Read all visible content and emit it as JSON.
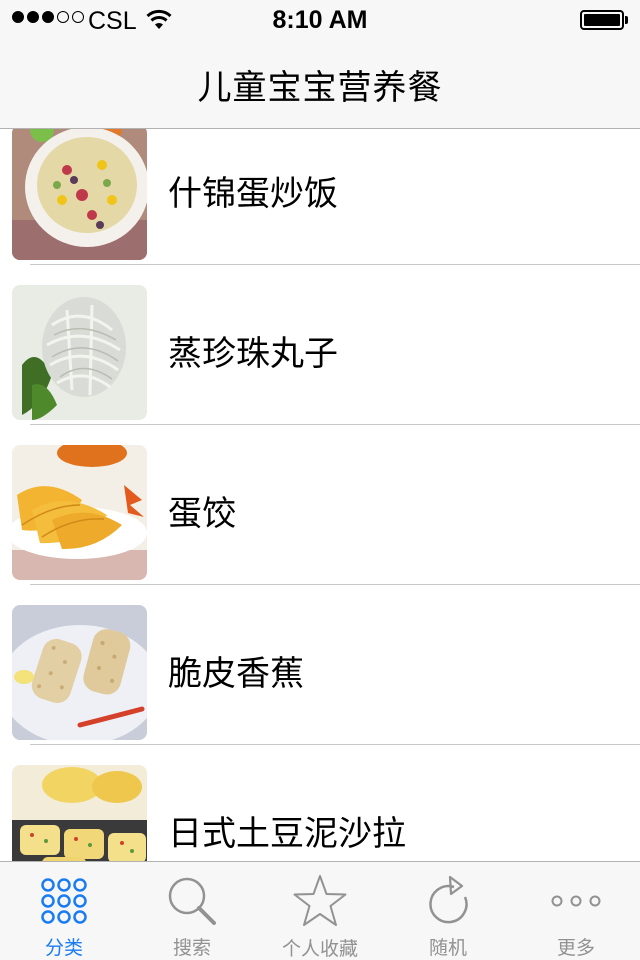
{
  "status_bar": {
    "carrier": "CSL",
    "time": "8:10 AM",
    "signal_bars_filled": 3,
    "signal_bars_total": 5
  },
  "nav": {
    "title": "儿童宝宝营养餐"
  },
  "list": {
    "items": [
      {
        "label": "什锦蛋炒饭",
        "thumb": "fried-rice"
      },
      {
        "label": "蒸珍珠丸子",
        "thumb": "pearl-meatballs"
      },
      {
        "label": "蛋饺",
        "thumb": "egg-dumplings"
      },
      {
        "label": "脆皮香蕉",
        "thumb": "crispy-banana"
      },
      {
        "label": "日式土豆泥沙拉",
        "thumb": "potato-salad"
      }
    ]
  },
  "tabs": [
    {
      "label": "分类",
      "icon": "grid-icon",
      "active": true
    },
    {
      "label": "搜索",
      "icon": "search-icon",
      "active": false
    },
    {
      "label": "个人收藏",
      "icon": "star-icon",
      "active": false
    },
    {
      "label": "随机",
      "icon": "refresh-icon",
      "active": false
    },
    {
      "label": "更多",
      "icon": "more-icon",
      "active": false
    }
  ],
  "colors": {
    "accent": "#1a7cf2",
    "inactive": "#929292",
    "bar_bg": "#f7f7f7"
  }
}
